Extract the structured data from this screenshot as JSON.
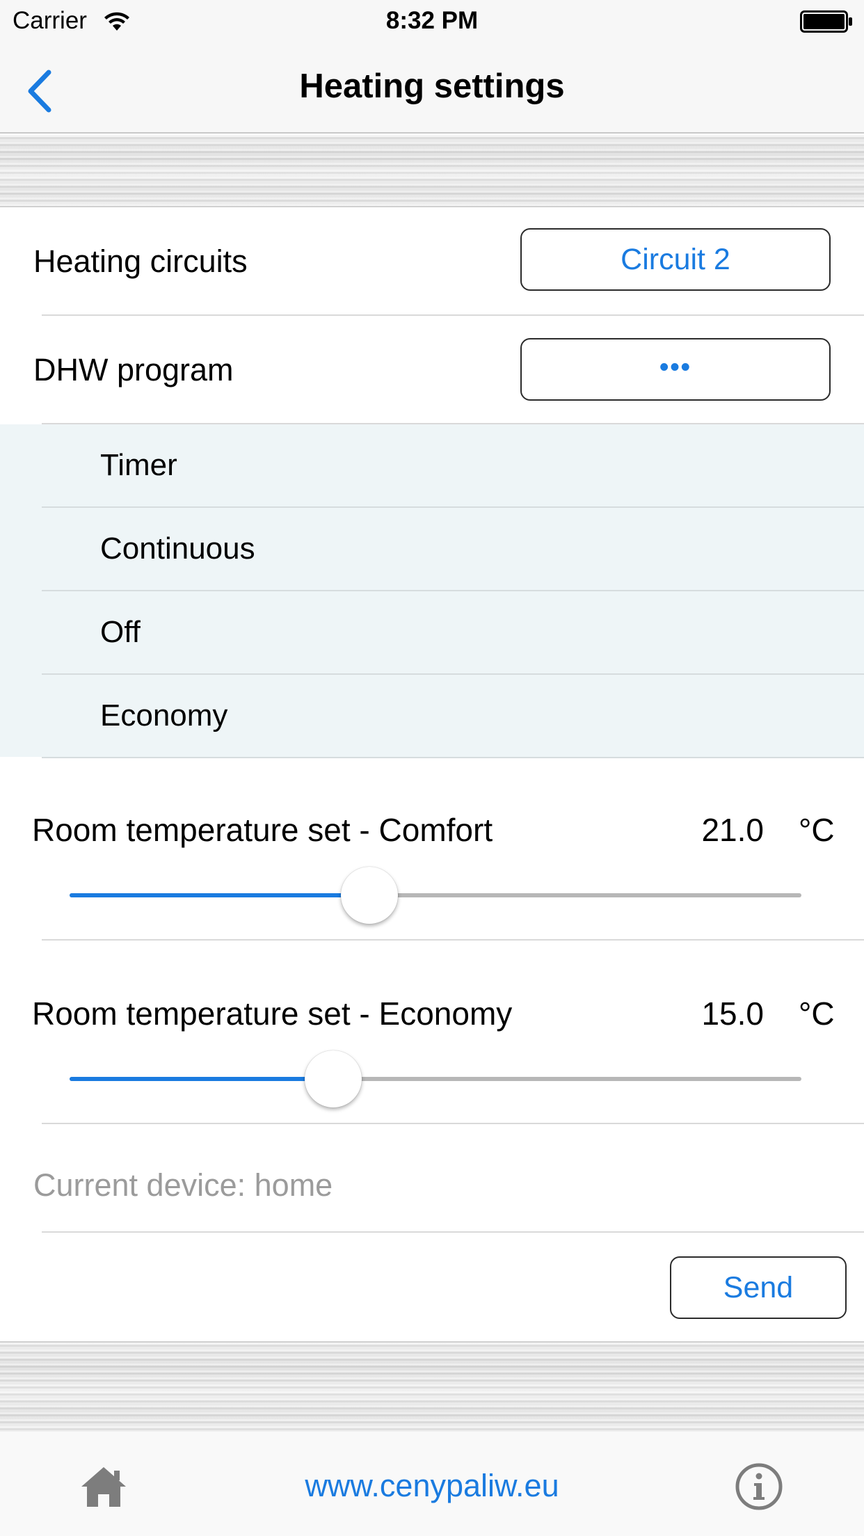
{
  "status_bar": {
    "carrier": "Carrier",
    "time": "8:32 PM"
  },
  "nav": {
    "title": "Heating settings",
    "back_icon": "chevron-left-icon"
  },
  "heating_circuits": {
    "label": "Heating circuits",
    "value": "Circuit 2"
  },
  "dhw_program": {
    "label": "DHW program",
    "value": "•••",
    "options": [
      "Timer",
      "Continuous",
      "Off",
      "Economy"
    ]
  },
  "comfort": {
    "label": "Room temperature set - Comfort",
    "value": "21.0",
    "unit": "°C",
    "slider_fraction": 0.41
  },
  "economy": {
    "label": "Room temperature set - Economy",
    "value": "15.0",
    "unit": "°C",
    "slider_fraction": 0.36
  },
  "device": {
    "text": "Current device: home"
  },
  "send": {
    "label": "Send"
  },
  "tab_bar": {
    "home_icon": "home-icon",
    "link": "www.cenypaliw.eu",
    "info_icon": "info-icon"
  },
  "colors": {
    "accent": "#1a7be0",
    "dropdown_bg": "#eef5f7",
    "placeholder": "#9b9b9b"
  }
}
